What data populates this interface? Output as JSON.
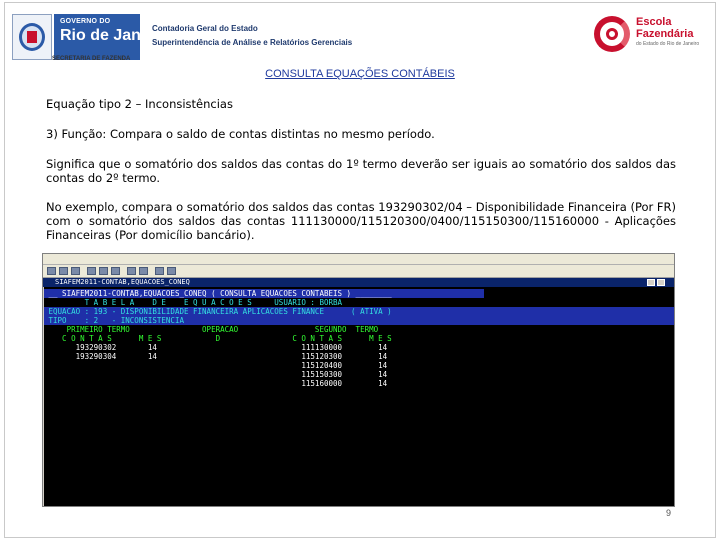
{
  "header": {
    "gov_logo_line1": "GOVERNO DO",
    "gov_logo_line2": "Rio de Janeiro",
    "gov_department": "SECRETARIA DE FAZENDA",
    "title_line1": "Contadoria Geral do Estado",
    "title_line2": "Superintendência de Análise e Relatórios Gerenciais",
    "school_logo_line1": "Escola",
    "school_logo_line2": "Fazendária",
    "school_logo_sub": "do Estado do Rio de Janeiro"
  },
  "slide": {
    "title": "CONSULTA EQUAÇÕES CONTÁBEIS",
    "paragraph1": "Equação tipo 2 – Inconsistências",
    "paragraph2": "3) Função: Compara o saldo de contas distintas no mesmo período.",
    "paragraph3": "Significa que o somatório dos saldos das contas do 1º termo deverão ser iguais ao somatório dos saldos das contas do 2º termo.",
    "paragraph4": "No exemplo, compara o somatório dos saldos das contas 193290302/04 – Disponibilidade Financeira (Por FR) com o somatório dos saldos das contas 111130000/115120300/0400/115150300/115160000 - Aplicações Financeiras (Por domicílio bancário).",
    "page_number": "9"
  },
  "terminal": {
    "window_title": "SIAFEM2011-CONTAB,EQUACOES_CONEQ",
    "lines": {
      "l1": " __ SIAFEM2011-CONTAB,EQUACOES_CONEQ ( CONSULTA EQUACOES CONTABEIS ) ________",
      "l2": "         T A B E L A    D E    E Q U A C O E S     USUARIO : BORBA",
      "l3": " EQUACAO : 193 - DISPONIBILIDADE FINANCEIRA APLICACOES FINANCE      ( ATIVA )",
      "l4": " TIPO    : 2   - INCONSISTENCIA",
      "l5": "     PRIMEIRO TERMO                OPERACAO                 SEGUNDO  TERMO",
      "l6": "    C O N T A S      M E S            D                C O N T A S      M E S",
      "l7": "       193290302       14                                111130000        14",
      "l8": "       193290304       14                                115120300        14",
      "l9": "                                                         115120400        14",
      "l10": "                                                         115150300        14",
      "l11": "                                                         115160000        14"
    }
  }
}
